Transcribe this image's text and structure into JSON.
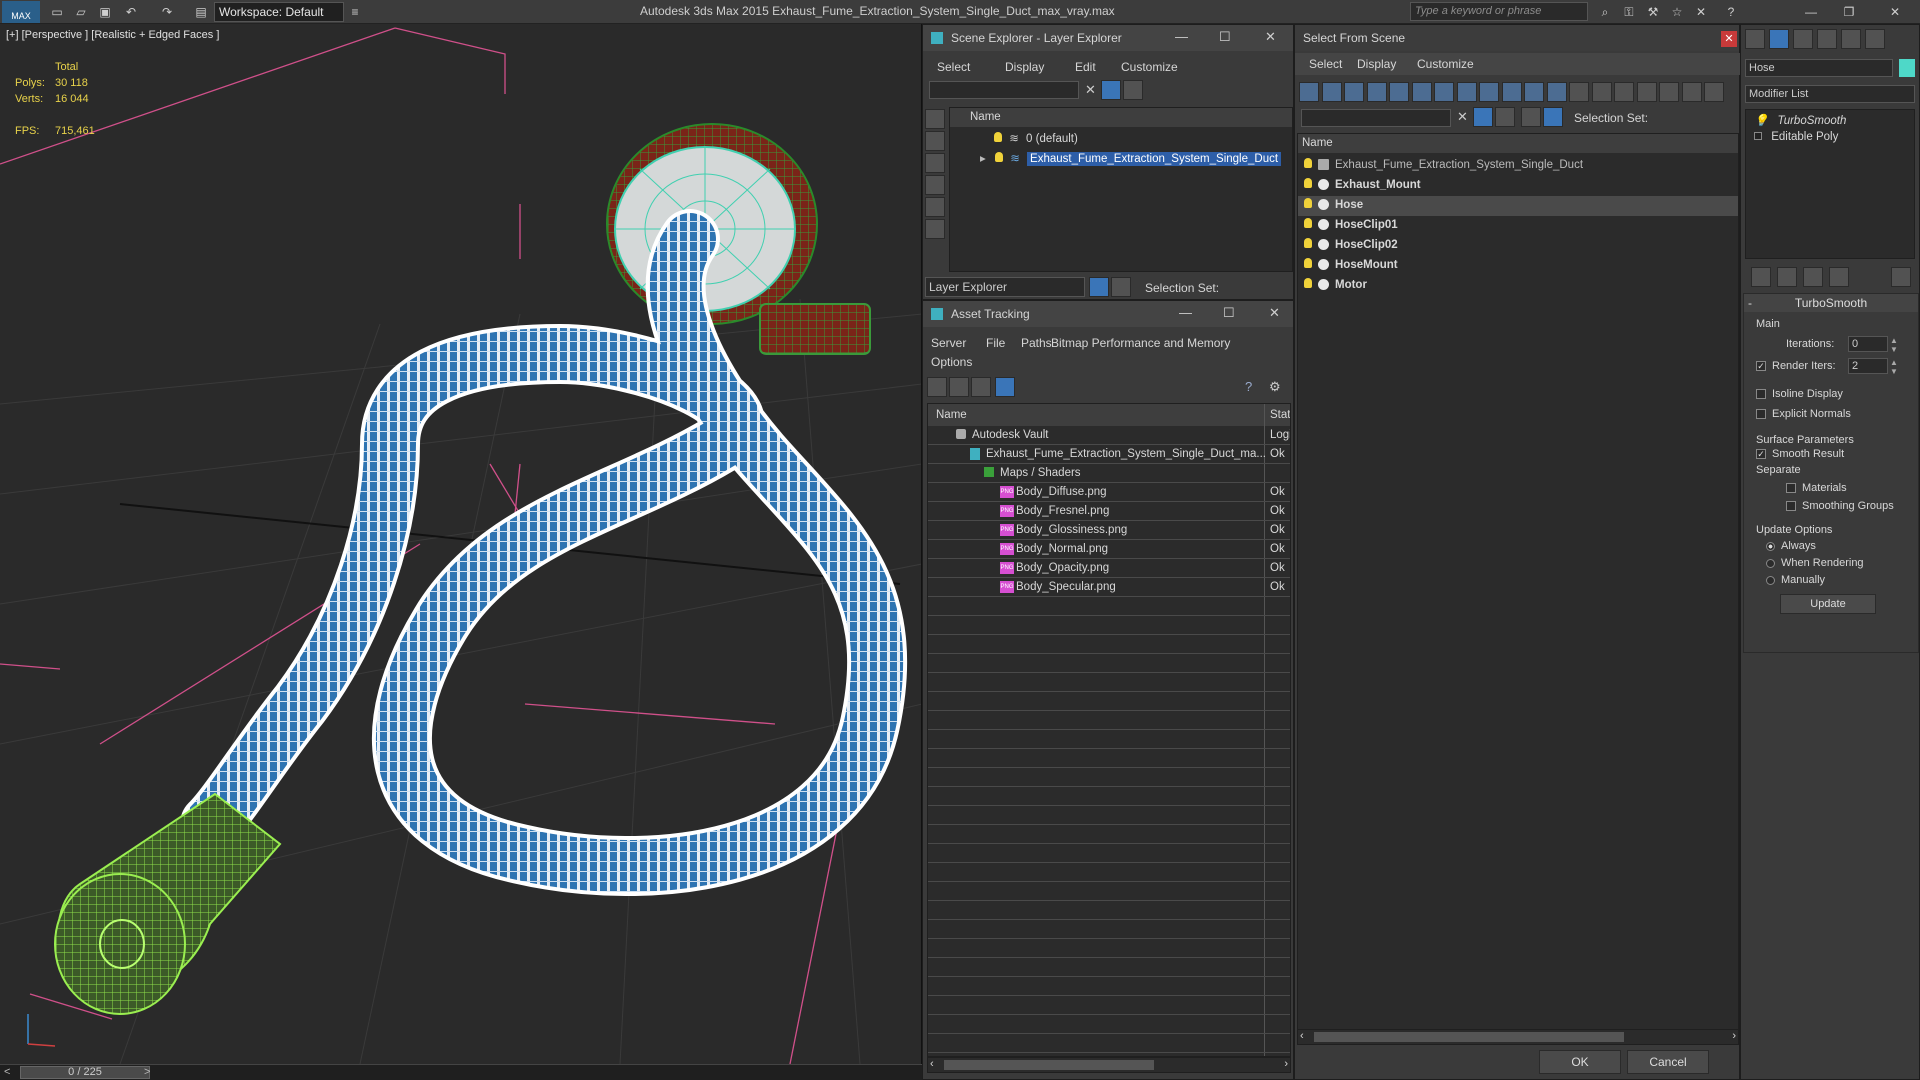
{
  "titlebar": {
    "workspace": "Workspace: Default",
    "title": "Autodesk 3ds Max  2015    Exhaust_Fume_Extraction_System_Single_Duct_max_vray.max",
    "search_placeholder": "Type a keyword or phrase"
  },
  "viewport": {
    "label": "[+] [Perspective ] [Realistic + Edged Faces ]",
    "total_label": "Total",
    "polys_label": "Polys:",
    "polys_value": "30 118",
    "verts_label": "Verts:",
    "verts_value": "16 044",
    "fps_label": "FPS:",
    "fps_value": "715,461"
  },
  "timeline": {
    "frame": "0 / 225",
    "prev": "<",
    "next": ">"
  },
  "scene_explorer": {
    "title": "Scene Explorer - Layer Explorer",
    "menu": [
      "Select",
      "Display",
      "Edit",
      "Customize"
    ],
    "col_name": "Name",
    "rows": [
      "0 (default)",
      "Exhaust_Fume_Extraction_System_Single_Duct"
    ],
    "footer_label": "Layer Explorer",
    "selection_set": "Selection Set:"
  },
  "asset_tracking": {
    "title": "Asset Tracking",
    "menu": [
      "Server",
      "File",
      "Paths",
      "Bitmap Performance and Memory",
      "Options"
    ],
    "col_name": "Name",
    "col_status": "Statu",
    "rows": [
      {
        "name": "Autodesk Vault",
        "status": "Logi"
      },
      {
        "name": "Exhaust_Fume_Extraction_System_Single_Duct_ma...",
        "status": "Ok"
      },
      {
        "name": "Maps / Shaders",
        "status": ""
      },
      {
        "name": "Body_Diffuse.png",
        "status": "Ok"
      },
      {
        "name": "Body_Fresnel.png",
        "status": "Ok"
      },
      {
        "name": "Body_Glossiness.png",
        "status": "Ok"
      },
      {
        "name": "Body_Normal.png",
        "status": "Ok"
      },
      {
        "name": "Body_Opacity.png",
        "status": "Ok"
      },
      {
        "name": "Body_Specular.png",
        "status": "Ok"
      }
    ]
  },
  "select_from_scene": {
    "title": "Select From Scene",
    "menu": [
      "Select",
      "Display",
      "Customize"
    ],
    "selection_set": "Selection Set:",
    "col_name": "Name",
    "rows": [
      "Exhaust_Fume_Extraction_System_Single_Duct",
      "Exhaust_Mount",
      "Hose",
      "HoseClip01",
      "HoseClip02",
      "HoseMount",
      "Motor"
    ],
    "ok": "OK",
    "cancel": "Cancel"
  },
  "modify_panel": {
    "object_name": "Hose",
    "modifier_list": "Modifier List",
    "stack": [
      "TurboSmooth",
      "Editable Poly"
    ],
    "rollout_title": "TurboSmooth",
    "main_label": "Main",
    "iterations_label": "Iterations:",
    "iterations_value": "0",
    "render_iters_label": "Render Iters:",
    "render_iters_value": "2",
    "isoline": "Isoline Display",
    "explicit_normals": "Explicit Normals",
    "surface_params": "Surface Parameters",
    "smooth_result": "Smooth Result",
    "separate": "Separate",
    "materials": "Materials",
    "smoothing_groups": "Smoothing Groups",
    "update_options": "Update Options",
    "always": "Always",
    "when_rendering": "When Rendering",
    "manually": "Manually",
    "update_button": "Update"
  }
}
